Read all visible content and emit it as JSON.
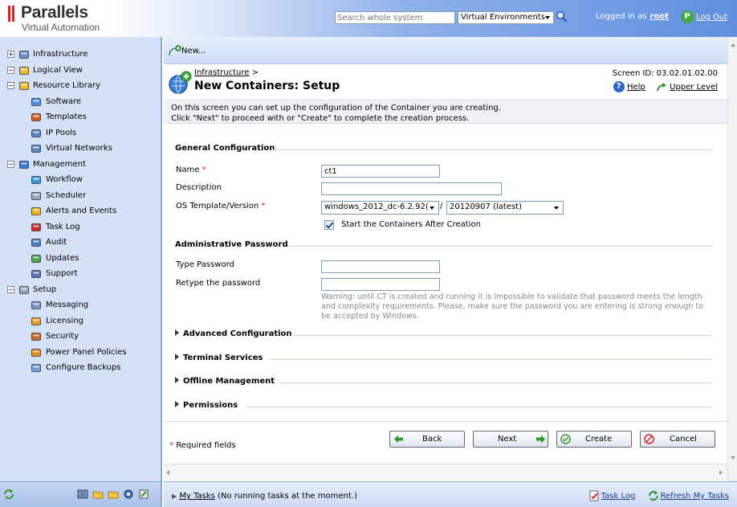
{
  "brand": {
    "name": "Parallels",
    "sub": "Virtual Automation"
  },
  "topbar": {
    "search_placeholder": "Search whole system",
    "scope_selected": "Virtual Environments",
    "logged_in_label": "Logged in as",
    "username": "root",
    "logout_label": "Log Out"
  },
  "sidebar": {
    "items": [
      {
        "label": "Infrastructure",
        "icon": "infrastructure-icon"
      },
      {
        "label": "Logical View",
        "icon": "logical-view-icon"
      },
      {
        "label": "Resource Library",
        "icon": "resource-library-icon"
      },
      {
        "label": "Software",
        "icon": "software-icon"
      },
      {
        "label": "Templates",
        "icon": "templates-icon"
      },
      {
        "label": "IP Pools",
        "icon": "ip-pools-icon"
      },
      {
        "label": "Virtual Networks",
        "icon": "virtual-networks-icon"
      },
      {
        "label": "Management",
        "icon": "management-icon"
      },
      {
        "label": "Workflow",
        "icon": "workflow-icon"
      },
      {
        "label": "Scheduler",
        "icon": "scheduler-icon"
      },
      {
        "label": "Alerts and Events",
        "icon": "alert-icon"
      },
      {
        "label": "Task Log",
        "icon": "task-log-icon"
      },
      {
        "label": "Audit",
        "icon": "audit-icon"
      },
      {
        "label": "Updates",
        "icon": "updates-icon"
      },
      {
        "label": "Support",
        "icon": "support-icon"
      },
      {
        "label": "Setup",
        "icon": "setup-icon"
      },
      {
        "label": "Messaging",
        "icon": "messaging-icon"
      },
      {
        "label": "Licensing",
        "icon": "licensing-icon"
      },
      {
        "label": "Security",
        "icon": "security-icon"
      },
      {
        "label": "Power Panel Policies",
        "icon": "power-panel-icon"
      },
      {
        "label": "Configure Backups",
        "icon": "backups-icon"
      }
    ]
  },
  "toolbar": {
    "new_label": "New..."
  },
  "header": {
    "breadcrumb": "Infrastructure",
    "breadcrumb_sep": ">",
    "title": "New Containers: Setup",
    "screen_id": "Screen ID: 03.02.01.02.00",
    "help_label": "Help",
    "upper_level_label": "Upper Level"
  },
  "intro": {
    "line1": "On this screen you can set up the configuration of the Container you are creating.",
    "line2": "Click \"Next\" to proceed with or \"Create\" to complete the creation process."
  },
  "form": {
    "general_title": "General Configuration",
    "name_label": "Name",
    "name_value": "ct1",
    "description_label": "Description",
    "description_value": "",
    "os_label": "OS Template/Version",
    "os_template_value": "windows_2012_dc-6.2.92(",
    "os_sep": "/",
    "os_version_value": "20120907 (latest)",
    "start_after_label": "Start the Containers After Creation",
    "start_after_checked": true,
    "admin_title": "Administrative Password",
    "type_password_label": "Type Password",
    "retype_password_label": "Retype the password",
    "warning": "Warning: until CT is created and running it is impossible to validate that password meets the length and complexity requirements. Please, make sure the password you are entering is strong enough to be accepted by Windows.",
    "advanced_title": "Advanced Configuration",
    "terminal_title": "Terminal Services",
    "offline_title": "Offline Management",
    "permissions_title": "Permissions",
    "required_asterisk": "*",
    "required_note": "Required fields"
  },
  "buttons": {
    "back": "Back",
    "next": "Next",
    "create": "Create",
    "cancel": "Cancel"
  },
  "status": {
    "my_tasks": "My Tasks",
    "my_tasks_note": "(No running tasks at the moment.)",
    "task_log": "Task Log",
    "refresh": "Refresh My Tasks"
  }
}
